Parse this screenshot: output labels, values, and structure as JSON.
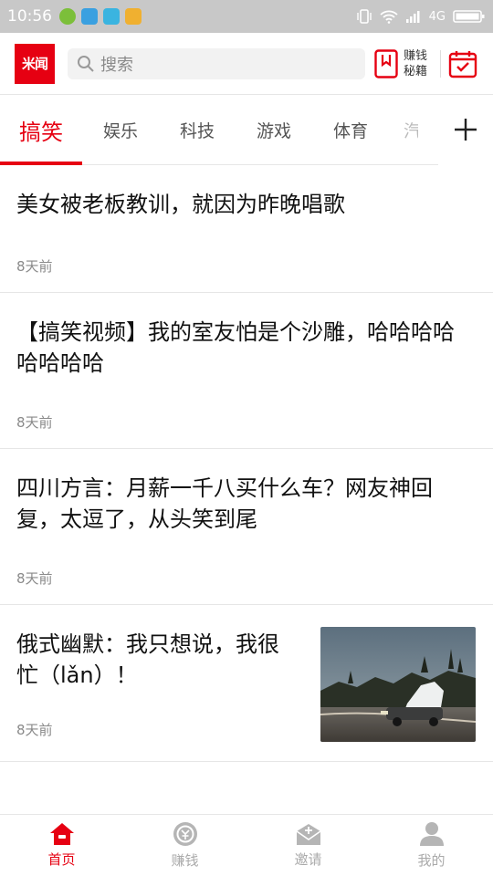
{
  "status_bar": {
    "time": "10:56",
    "network": "4G"
  },
  "header": {
    "logo_text": "米闻",
    "search_placeholder": "搜索",
    "earn_line1": "赚钱",
    "earn_line2": "秘籍"
  },
  "tabs": [
    {
      "label": "搞笑",
      "active": true
    },
    {
      "label": "娱乐"
    },
    {
      "label": "科技"
    },
    {
      "label": "游戏"
    },
    {
      "label": "体育"
    },
    {
      "label": "汽"
    }
  ],
  "articles": [
    {
      "title": "美女被老板教训，就因为昨晚唱歌",
      "time": "8天前"
    },
    {
      "title": "【搞笑视频】我的室友怕是个沙雕，哈哈哈哈哈哈哈哈",
      "time": "8天前"
    },
    {
      "title": "四川方言：月薪一千八买什么车？网友神回复，太逗了，从头笑到尾",
      "time": "8天前"
    },
    {
      "title": "俄式幽默：我只想说，我很忙（lǎn）！",
      "time": "8天前",
      "has_thumbnail": true
    }
  ],
  "bottom_nav": [
    {
      "label": "首页",
      "icon": "home-icon",
      "active": true
    },
    {
      "label": "赚钱",
      "icon": "coin-icon"
    },
    {
      "label": "邀请",
      "icon": "envelope-icon"
    },
    {
      "label": "我的",
      "icon": "person-icon"
    }
  ],
  "colors": {
    "accent": "#e60012",
    "status_bar": "#c8c8c8",
    "muted_text": "#8a8a8a"
  }
}
